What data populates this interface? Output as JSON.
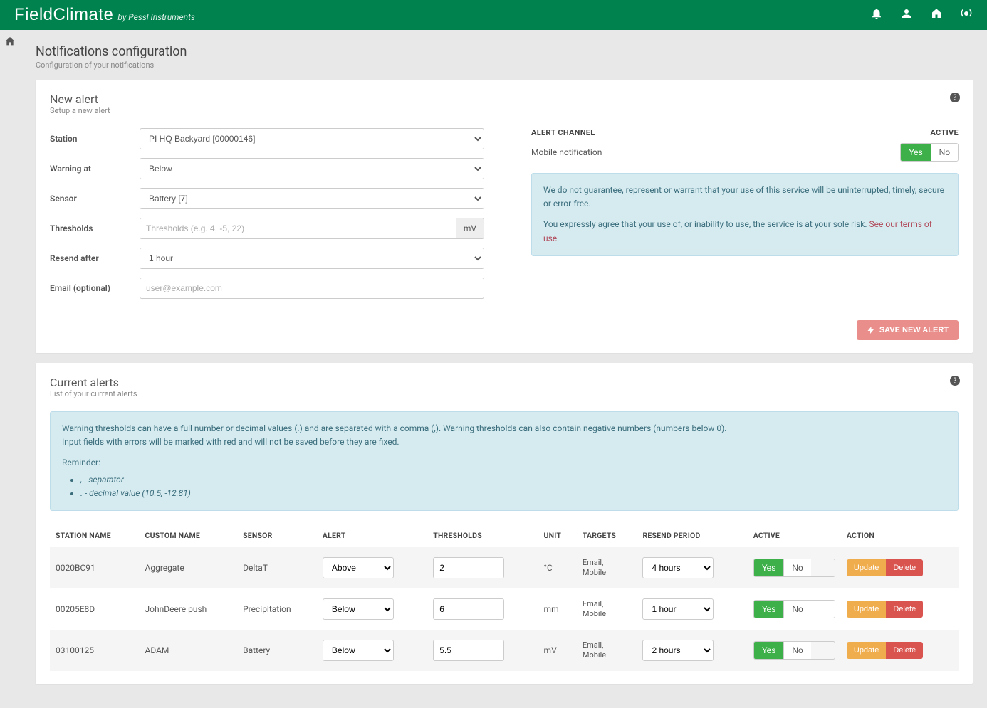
{
  "brand": {
    "name": "FieldClimate",
    "byline": "by Pessl Instruments"
  },
  "page": {
    "title": "Notifications configuration",
    "subtitle": "Configuration of your notifications"
  },
  "newAlert": {
    "title": "New alert",
    "subtitle": "Setup a new alert",
    "labels": {
      "station": "Station",
      "warning_at": "Warning at",
      "sensor": "Sensor",
      "thresholds": "Thresholds",
      "resend_after": "Resend after",
      "email": "Email (optional)"
    },
    "values": {
      "station": "PI HQ Backyard [00000146]",
      "warning_at": "Below",
      "sensor": "Battery [7]",
      "thresholds_placeholder": "Thresholds (e.g. 4, -5, 22)",
      "thresholds_unit": "mV",
      "resend_after": "1 hour",
      "email_placeholder": "user@example.com"
    },
    "channel": {
      "header_left": "ALERT CHANNEL",
      "header_right": "ACTIVE",
      "row_label": "Mobile notification",
      "yes": "Yes",
      "no": "No"
    },
    "warning": {
      "p1": "We do not guarantee, represent or warrant that your use of this service will be uninterrupted, timely, secure or error-free.",
      "p2_pre": "You expressly agree that your use of, or inability to use, the service is at your sole risk. ",
      "p2_link": "See our terms of use."
    },
    "save_label": "SAVE NEW ALERT"
  },
  "currentAlerts": {
    "title": "Current alerts",
    "subtitle": "List of your current alerts",
    "tip": {
      "p1": "Warning thresholds can have a full number or decimal values (.) and are separated with a comma (,). Warning thresholds can also contain negative numbers (numbers below 0).",
      "p2": "Input fields with errors will be marked with red and will not be saved before they are fixed.",
      "reminder": "Reminder:",
      "b1": ", - separator",
      "b2": ". - decimal value (10.5, -12.81)"
    },
    "columns": {
      "station": "STATION NAME",
      "custom": "CUSTOM NAME",
      "sensor": "SENSOR",
      "alert": "ALERT",
      "thresholds": "THRESHOLDS",
      "unit": "UNIT",
      "targets": "TARGETS",
      "resend": "RESEND PERIOD",
      "active": "ACTIVE",
      "action": "ACTION"
    },
    "toggles": {
      "yes": "Yes",
      "no": "No"
    },
    "actions": {
      "update": "Update",
      "delete": "Delete"
    },
    "rows": [
      {
        "station": "0020BC91",
        "custom": "Aggregate",
        "sensor": "DeltaT",
        "alert": "Above",
        "thresholds": "2",
        "unit": "°C",
        "targets": "Email,\nMobile",
        "resend": "4 hours"
      },
      {
        "station": "00205E8D",
        "custom": "JohnDeere push",
        "sensor": "Precipitation",
        "alert": "Below",
        "thresholds": "6",
        "unit": "mm",
        "targets": "Email,\nMobile",
        "resend": "1 hour"
      },
      {
        "station": "03100125",
        "custom": "ADAM",
        "sensor": "Battery",
        "alert": "Below",
        "thresholds": "5.5",
        "unit": "mV",
        "targets": "Email,\nMobile",
        "resend": "2 hours"
      }
    ]
  }
}
